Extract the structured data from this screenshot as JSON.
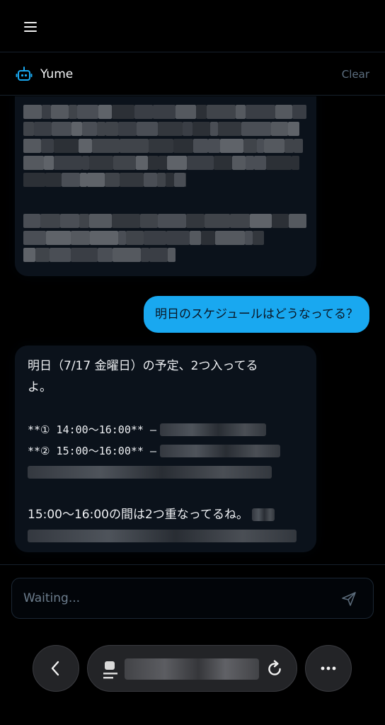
{
  "header": {
    "menu_icon": "hamburger-menu-icon"
  },
  "chat": {
    "title": "Yume",
    "title_icon": "robot-icon",
    "clear_label": "Clear",
    "accent_color": "#19a8f0"
  },
  "messages": {
    "user_message": "明日のスケジュールはどうなってる？",
    "bot_reply": {
      "line1": "明日（7/17 金曜日）の予定、2つ入ってる",
      "line2": "よ。",
      "item1_prefix": "**① 14:00〜16:00** –",
      "item2_prefix": "**② 15:00〜16:00** –",
      "summary": "15:00〜16:00の間は2つ重なってるね。"
    }
  },
  "composer": {
    "placeholder": "Waiting...",
    "send_icon": "send-icon"
  },
  "browser_nav": {
    "back_icon": "chevron-left-icon",
    "site_icon": "site-favicon-icon",
    "reload_icon": "reload-icon",
    "more_icon": "more-dots-icon"
  }
}
